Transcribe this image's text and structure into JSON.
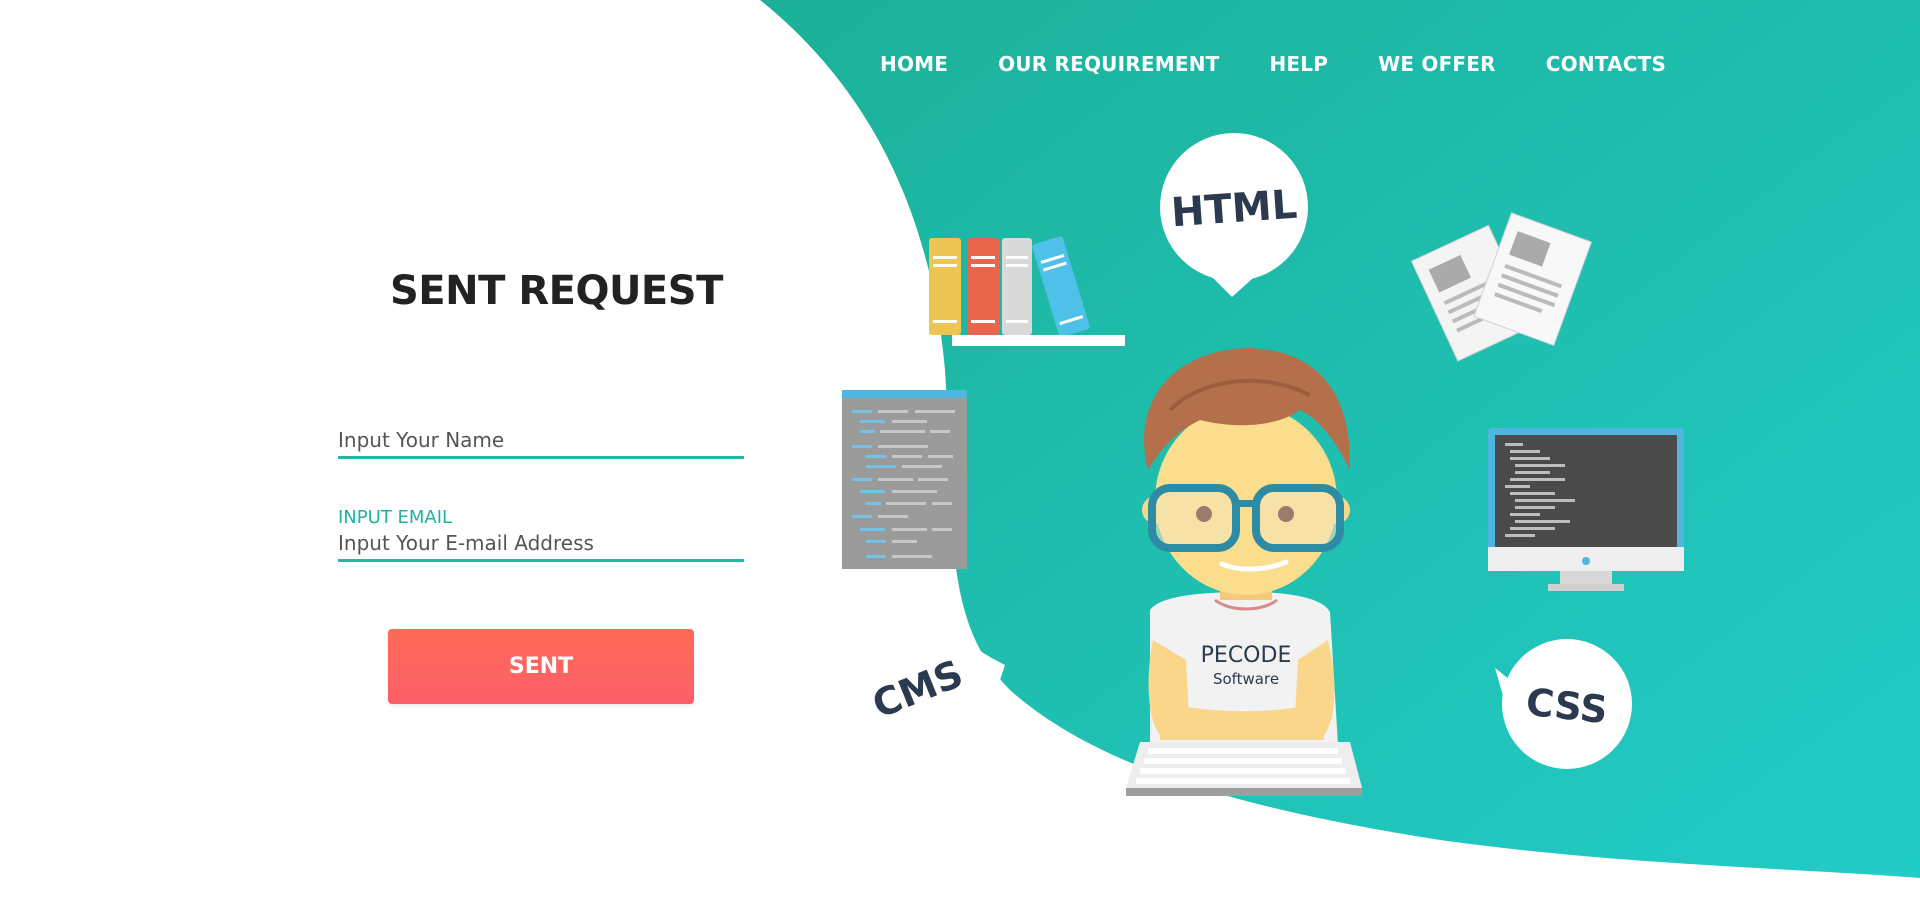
{
  "colors": {
    "teal_light": "#1dbfa6",
    "teal_dark": "#1cb198",
    "accent_red": "#ff6657",
    "text_dark": "#222222",
    "white": "#ffffff"
  },
  "nav": {
    "items": [
      {
        "label": "HOME"
      },
      {
        "label": "OUR REQUIREMENT"
      },
      {
        "label": "HELP"
      },
      {
        "label": "WE OFFER"
      },
      {
        "label": "CONTACTS"
      }
    ]
  },
  "form": {
    "title": "SENT REQUEST",
    "name_placeholder": "Input Your Name",
    "email_label": "INPUT EMAIL",
    "email_placeholder": "Input Your E-mail Address",
    "submit_label": "SENT"
  },
  "illustration": {
    "bubble_html": "HTML",
    "bubble_css": "CSS",
    "label_cms": "CMS",
    "shirt_line1": "PECODE",
    "shirt_line2": "Software",
    "icons": [
      "books-icon",
      "documents-icon",
      "code-editor-icon",
      "monitor-icon",
      "keyboard-icon",
      "developer-avatar"
    ]
  }
}
